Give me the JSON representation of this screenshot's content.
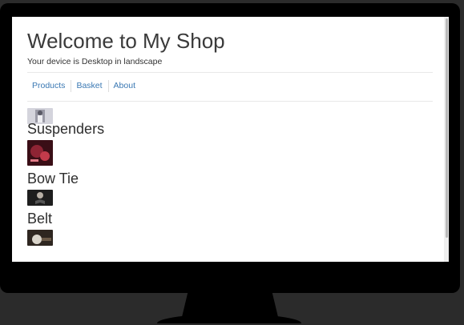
{
  "header": {
    "title": "Welcome to My Shop",
    "device_line": "Your device is Desktop in landscape"
  },
  "nav": {
    "items": [
      {
        "label": "Products"
      },
      {
        "label": "Basket"
      },
      {
        "label": "About"
      }
    ]
  },
  "products": [
    {
      "name": "",
      "thumb_icon": "shirt-photo-icon",
      "thumb_color": "#c9c9d2"
    },
    {
      "name": "Suspenders",
      "thumb_icon": "suspenders-photo-icon",
      "thumb_color": "#7a1f2b"
    },
    {
      "name": "Bow Tie",
      "thumb_icon": "bowtie-photo-icon",
      "thumb_color": "#2a2a2a"
    },
    {
      "name": "Belt",
      "thumb_icon": "belt-photo-icon",
      "thumb_color": "#3b3128"
    }
  ],
  "colors": {
    "link": "#3a78b3",
    "bezel": "#000000",
    "backdrop": "#2b2b2b"
  }
}
